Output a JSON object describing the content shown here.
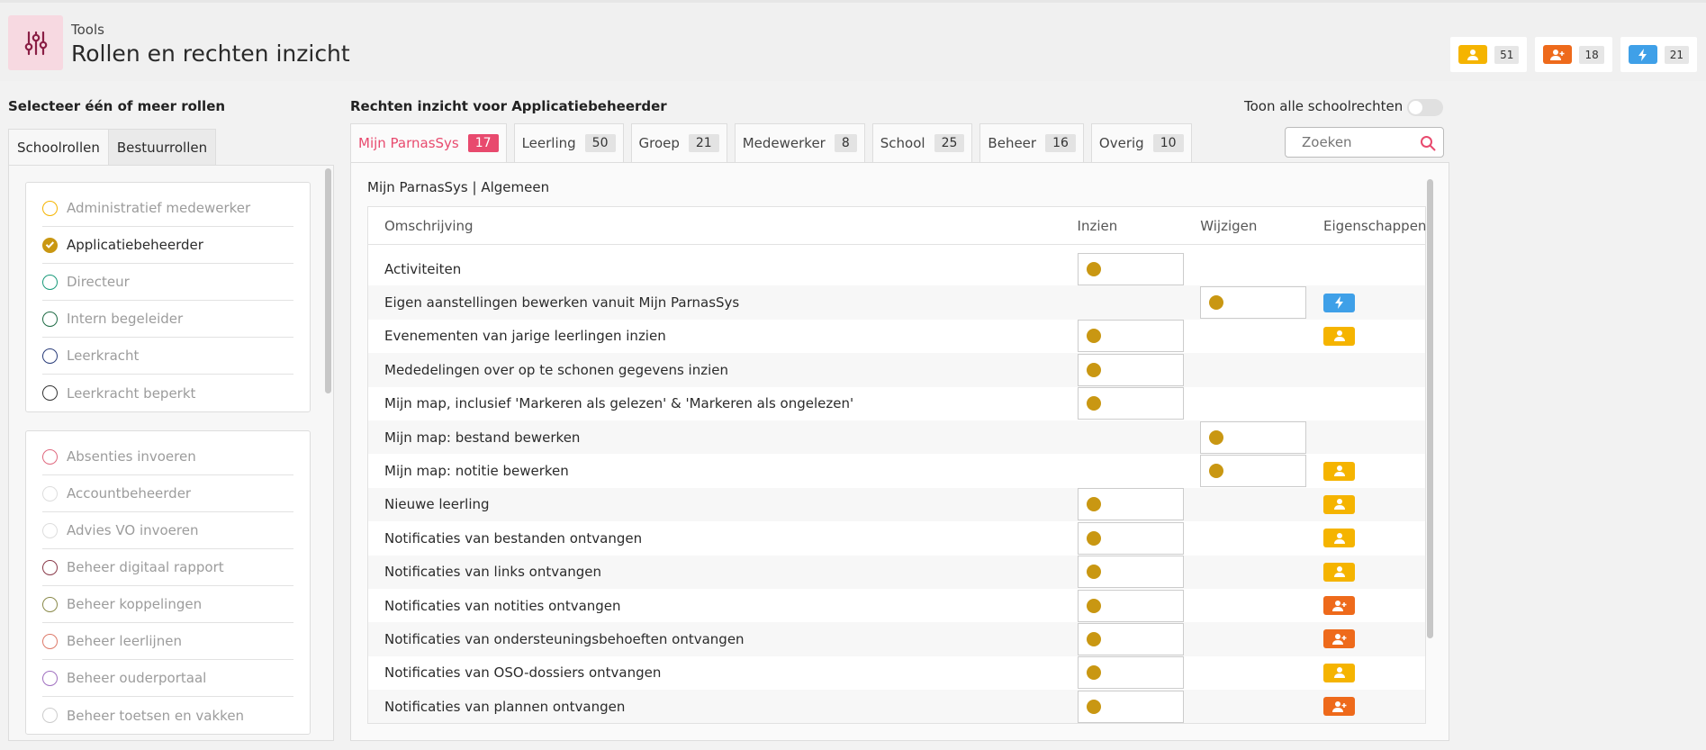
{
  "header": {
    "subtitle": "Tools",
    "title": "Rollen en rechten inzicht",
    "stats": [
      {
        "icon": "user-icon",
        "color": "#f5b400",
        "count": "51"
      },
      {
        "icon": "user-plus-icon",
        "color": "#ee6a1b",
        "count": "18"
      },
      {
        "icon": "lightning-icon",
        "color": "#3fa0e8",
        "count": "21"
      }
    ]
  },
  "left": {
    "heading": "Selecteer één of meer rollen",
    "tabs": [
      "Schoolrollen",
      "Bestuurrollen"
    ],
    "group1": [
      {
        "label": "Administratief medewerker",
        "color": "#f5b400",
        "checked": false
      },
      {
        "label": "Applicatiebeheerder",
        "color": "#c99712",
        "checked": true
      },
      {
        "label": "Directeur",
        "color": "#1a9a7a",
        "checked": false
      },
      {
        "label": "Intern begeleider",
        "color": "#1f6b45",
        "checked": false
      },
      {
        "label": "Leerkracht",
        "color": "#2a3d7a",
        "checked": false
      },
      {
        "label": "Leerkracht beperkt",
        "color": "#333333",
        "checked": false
      }
    ],
    "group2": [
      {
        "label": "Absenties invoeren",
        "color": "#e06a80"
      },
      {
        "label": "Accountbeheerder",
        "color": "#dddddd"
      },
      {
        "label": "Advies VO invoeren",
        "color": "#dddddd"
      },
      {
        "label": "Beheer digitaal rapport",
        "color": "#8a3a4a"
      },
      {
        "label": "Beheer koppelingen",
        "color": "#8a8a4a"
      },
      {
        "label": "Beheer leerlijnen",
        "color": "#dd7a6a"
      },
      {
        "label": "Beheer ouderportaal",
        "color": "#a070c0"
      },
      {
        "label": "Beheer toetsen en vakken",
        "color": "#cccccc"
      }
    ]
  },
  "right": {
    "heading": "Rechten inzicht voor Applicatiebeheerder",
    "toggle_label": "Toon alle schoolrechten",
    "search_placeholder": "Zoeken",
    "tabs": [
      {
        "label": "Mijn ParnasSys",
        "count": "17",
        "active": true
      },
      {
        "label": "Leerling",
        "count": "50"
      },
      {
        "label": "Groep",
        "count": "21"
      },
      {
        "label": "Medewerker",
        "count": "8"
      },
      {
        "label": "School",
        "count": "25"
      },
      {
        "label": "Beheer",
        "count": "16"
      },
      {
        "label": "Overig",
        "count": "10"
      }
    ],
    "section_title": "Mijn ParnasSys | Algemeen",
    "columns": [
      "Omschrijving",
      "Inzien",
      "Wijzigen",
      "Eigenschappen"
    ],
    "rows": [
      {
        "desc": "Activiteiten",
        "inzien": true,
        "wijzigen": false,
        "prop": ""
      },
      {
        "desc": "Eigen aanstellingen bewerken vanuit Mijn ParnasSys",
        "inzien": false,
        "wijzigen": true,
        "prop": "lightning"
      },
      {
        "desc": "Evenementen van jarige leerlingen inzien",
        "inzien": true,
        "wijzigen": false,
        "prop": "user"
      },
      {
        "desc": "Mededelingen over op te schonen gegevens inzien",
        "inzien": true,
        "wijzigen": false,
        "prop": ""
      },
      {
        "desc": "Mijn map, inclusief 'Markeren als gelezen' & 'Markeren als ongelezen'",
        "inzien": true,
        "wijzigen": false,
        "prop": ""
      },
      {
        "desc": "Mijn map: bestand bewerken",
        "inzien": false,
        "wijzigen": true,
        "prop": ""
      },
      {
        "desc": "Mijn map: notitie bewerken",
        "inzien": false,
        "wijzigen": true,
        "prop": "user"
      },
      {
        "desc": "Nieuwe leerling",
        "inzien": true,
        "wijzigen": false,
        "prop": "user"
      },
      {
        "desc": "Notificaties van bestanden ontvangen",
        "inzien": true,
        "wijzigen": false,
        "prop": "user"
      },
      {
        "desc": "Notificaties van links ontvangen",
        "inzien": true,
        "wijzigen": false,
        "prop": "user"
      },
      {
        "desc": "Notificaties van notities ontvangen",
        "inzien": true,
        "wijzigen": false,
        "prop": "user-plus"
      },
      {
        "desc": "Notificaties van ondersteuningsbehoeften ontvangen",
        "inzien": true,
        "wijzigen": false,
        "prop": "user-plus"
      },
      {
        "desc": "Notificaties van OSO-dossiers ontvangen",
        "inzien": true,
        "wijzigen": false,
        "prop": "user"
      },
      {
        "desc": "Notificaties van plannen ontvangen",
        "inzien": true,
        "wijzigen": false,
        "prop": "user-plus"
      }
    ]
  }
}
